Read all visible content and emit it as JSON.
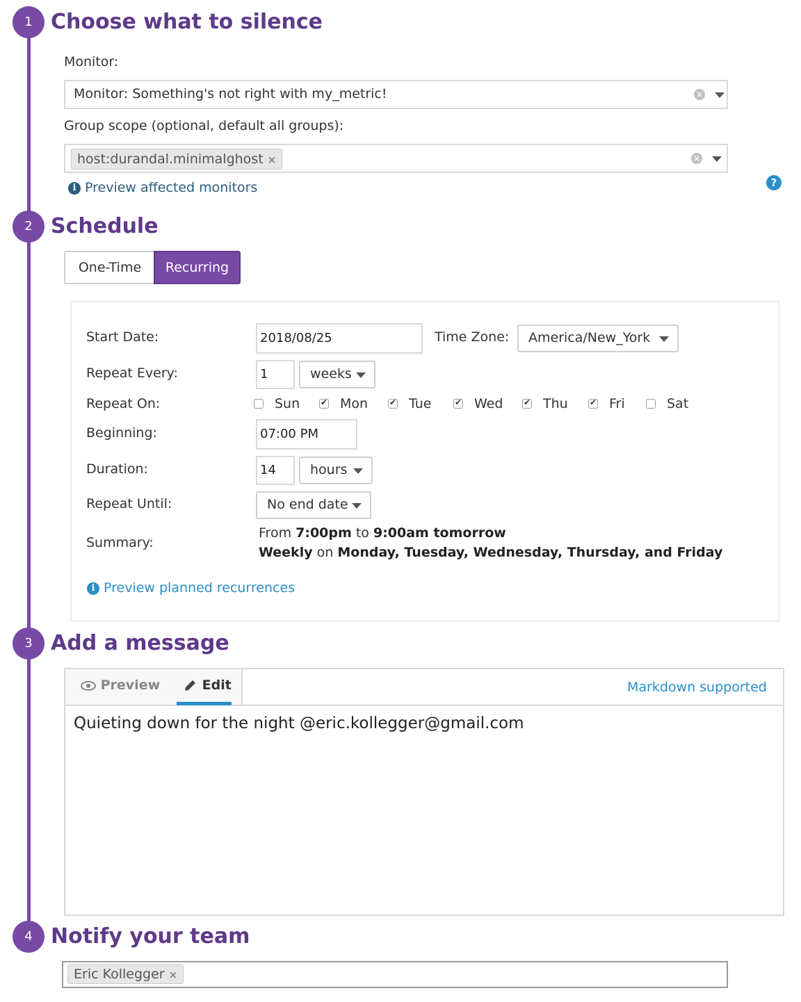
{
  "steps": [
    {
      "number": "1",
      "title": "Choose what to silence"
    },
    {
      "number": "2",
      "title": "Schedule"
    },
    {
      "number": "3",
      "title": "Add a message"
    },
    {
      "number": "4",
      "title": "Notify your team"
    }
  ],
  "silence": {
    "monitor_label": "Monitor:",
    "monitor_value": "Monitor: Something's not right with my_metric!",
    "group_label": "Group scope (optional, default all groups):",
    "group_tag": "host:durandal.minimalghost",
    "preview_link": "Preview affected monitors"
  },
  "schedule": {
    "tabs": [
      {
        "label": "One-Time",
        "active": false
      },
      {
        "label": "Recurring",
        "active": true
      }
    ],
    "start_date_label": "Start Date:",
    "start_date": "2018/08/25",
    "timezone_label": "Time Zone:",
    "timezone": "America/New_York",
    "repeat_every_label": "Repeat Every:",
    "repeat_every_value": "1",
    "repeat_every_unit": "weeks",
    "repeat_on_label": "Repeat On:",
    "days": [
      {
        "label": "Sun",
        "checked": false
      },
      {
        "label": "Mon",
        "checked": true
      },
      {
        "label": "Tue",
        "checked": true
      },
      {
        "label": "Wed",
        "checked": true
      },
      {
        "label": "Thu",
        "checked": true
      },
      {
        "label": "Fri",
        "checked": true
      },
      {
        "label": "Sat",
        "checked": false
      }
    ],
    "beginning_label": "Beginning:",
    "beginning_value": "07:00 PM",
    "duration_label": "Duration:",
    "duration_value": "14",
    "duration_unit": "hours",
    "repeat_until_label": "Repeat Until:",
    "repeat_until_value": "No end date",
    "summary_label": "Summary:",
    "summary": {
      "from": "From",
      "start": "7:00pm",
      "to": "to",
      "end": "9:00am tomorrow",
      "freq": "Weekly",
      "on": "on",
      "days_text": "Monday, Tuesday, Wednesday, Thursday, and Friday"
    },
    "preview_link": "Preview planned recurrences"
  },
  "message": {
    "tab_preview": "Preview",
    "tab_edit": "Edit",
    "markdown_link": "Markdown supported",
    "text": "Quieting down for the night @eric.kollegger@gmail.com"
  },
  "notify": {
    "recipient": "Eric Kollegger"
  },
  "icons": {
    "info": "i",
    "help": "?",
    "clear": "×",
    "remove": "×"
  },
  "colors": {
    "accent": "#774aa4",
    "title": "#5f3a8a",
    "link": "#2a8fc9"
  }
}
